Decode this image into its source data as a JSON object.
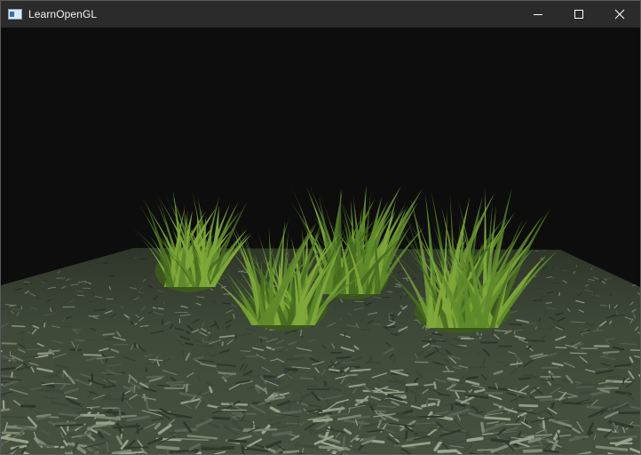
{
  "window": {
    "title": "LearnOpenGL",
    "icon": "app-window-icon",
    "controls": {
      "minimize": "minimize-icon",
      "maximize": "maximize-icon",
      "close": "close-icon"
    }
  },
  "scene": {
    "clear_color": "#0d0d0d",
    "ground_texture": "grass-ground",
    "ground_colors": [
      "#3f4a3c",
      "#5a6656",
      "#2f3a2d",
      "#7d8a74",
      "#9aa58f"
    ],
    "foliage_color": "#5f8a2a",
    "foliage_highlight": "#7fa83a",
    "objects": [
      "grass-clump",
      "grass-clump",
      "grass-clump",
      "grass-clump"
    ]
  }
}
